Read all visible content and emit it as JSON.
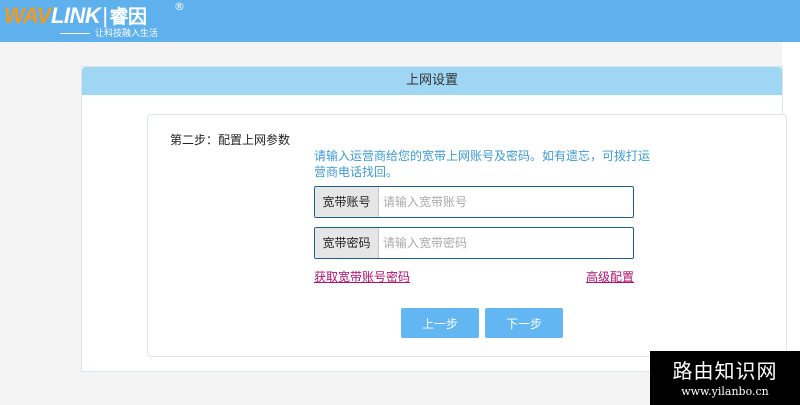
{
  "header": {
    "logo": {
      "brand_wa": "WAV",
      "brand_link": "LINK",
      "brand_separator": "|",
      "brand_cn": "睿因",
      "registered": "®",
      "tagline": "让科技融入生活"
    }
  },
  "panel": {
    "title": "上网设置",
    "step_label": "第二步：配置上网参数",
    "hint": "请输入运营商给您的宽带上网账号及密码。如有遗忘，可拨打运营商电话找回。",
    "fields": {
      "account": {
        "label": "宽带账号",
        "placeholder": "请输入宽带账号",
        "value": ""
      },
      "password": {
        "label": "宽带密码",
        "placeholder": "请输入宽带密码",
        "value": ""
      }
    },
    "links": {
      "get_account": "获取宽带账号密码",
      "advanced": "高级配置"
    },
    "buttons": {
      "prev": "上一步",
      "next": "下一步"
    }
  },
  "watermark": {
    "title": "路由知识网",
    "url": "www.yilanbo.cn"
  },
  "colors": {
    "header_bg": "#5fb1ee",
    "panel_header_bg": "#9fd6f3",
    "hint_text": "#3d9bd4",
    "link": "#b0126b",
    "button_bg": "#62b6f2",
    "field_border": "#1e5f8b"
  }
}
